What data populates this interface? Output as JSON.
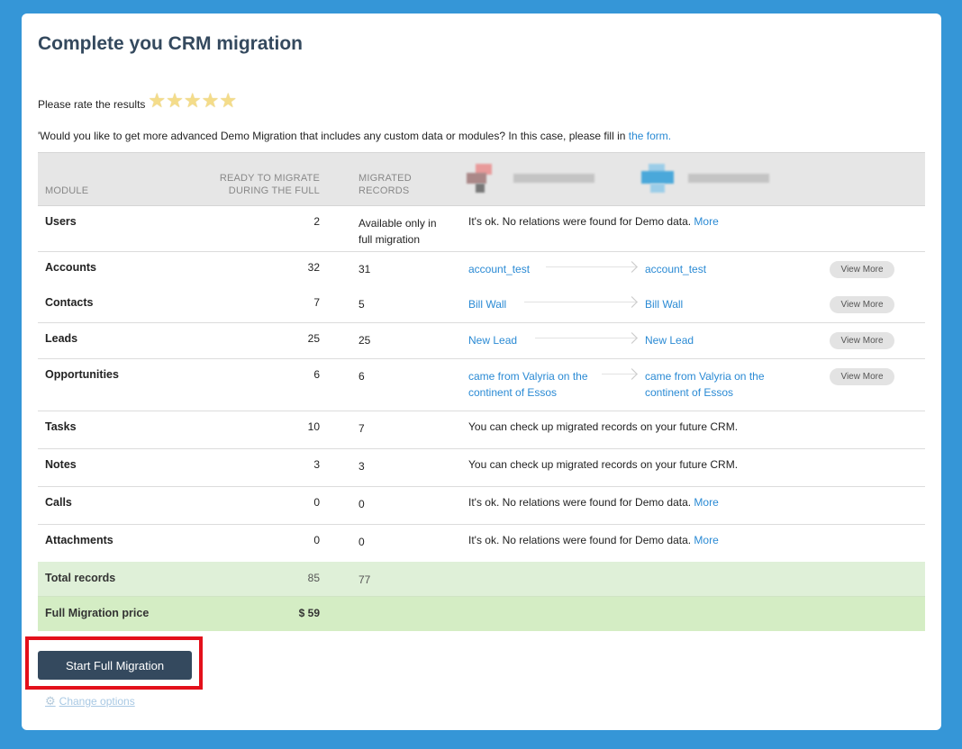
{
  "title": "Complete you CRM migration",
  "rating": {
    "label": "Please rate the results",
    "stars": 5,
    "star_color": "#f4dc8a"
  },
  "demo": {
    "text": "'Would you like to get more advanced Demo Migration that includes any custom data or modules? In this case, please fill in ",
    "link": "the form."
  },
  "table": {
    "headers": {
      "module": "MODULE",
      "ready_1": "READY TO MIGRATE",
      "ready_2": "DURING THE FULL",
      "migrated_1": "MIGRATED",
      "migrated_2": "RECORDS"
    },
    "rows": [
      {
        "module": "Users",
        "ready": "2",
        "migrated_1": "Available only in",
        "migrated_2": "full migration",
        "info": "It's ok. No relations were found for Demo data.",
        "more": "More"
      },
      {
        "module": "Accounts",
        "ready": "32",
        "migrated": "31",
        "src": "account_test",
        "tgt": "account_test",
        "view_more": "View More"
      },
      {
        "module": "Contacts",
        "ready": "7",
        "migrated": "5",
        "src": "Bill Wall",
        "tgt": "Bill Wall",
        "view_more": "View More"
      },
      {
        "module": "Leads",
        "ready": "25",
        "migrated": "25",
        "src": "New Lead",
        "tgt": "New Lead",
        "view_more": "View More"
      },
      {
        "module": "Opportunities",
        "ready": "6",
        "migrated": "6",
        "src_1": "came from Valyria on the",
        "src_2": "continent of Essos",
        "tgt_1": "came from Valyria on the",
        "tgt_2": "continent of Essos",
        "view_more": "View More"
      },
      {
        "module": "Tasks",
        "ready": "10",
        "migrated": "7",
        "info": "You can check up migrated records on your future CRM."
      },
      {
        "module": "Notes",
        "ready": "3",
        "migrated": "3",
        "info": "You can check up migrated records on your future CRM."
      },
      {
        "module": "Calls",
        "ready": "0",
        "migrated": "0",
        "info": "It's ok. No relations were found for Demo data.",
        "more": "More"
      },
      {
        "module": "Attachments",
        "ready": "0",
        "migrated": "0",
        "info": "It's ok. No relations were found for Demo data.",
        "more": "More"
      }
    ],
    "total": {
      "label": "Total records",
      "ready": "85",
      "migrated": "77"
    },
    "price": {
      "label": "Full Migration price",
      "value": "$ 59"
    }
  },
  "cta": {
    "label": "Start Full Migration"
  },
  "change_options": {
    "label": "Change options",
    "icon": "gear-icon"
  },
  "colors": {
    "page_bg": "#3596d7",
    "title": "#34495e",
    "link": "#2a8ad4",
    "button": "#34495e",
    "highlight": "#e3101b",
    "summary_bg": "#dff0d8"
  }
}
